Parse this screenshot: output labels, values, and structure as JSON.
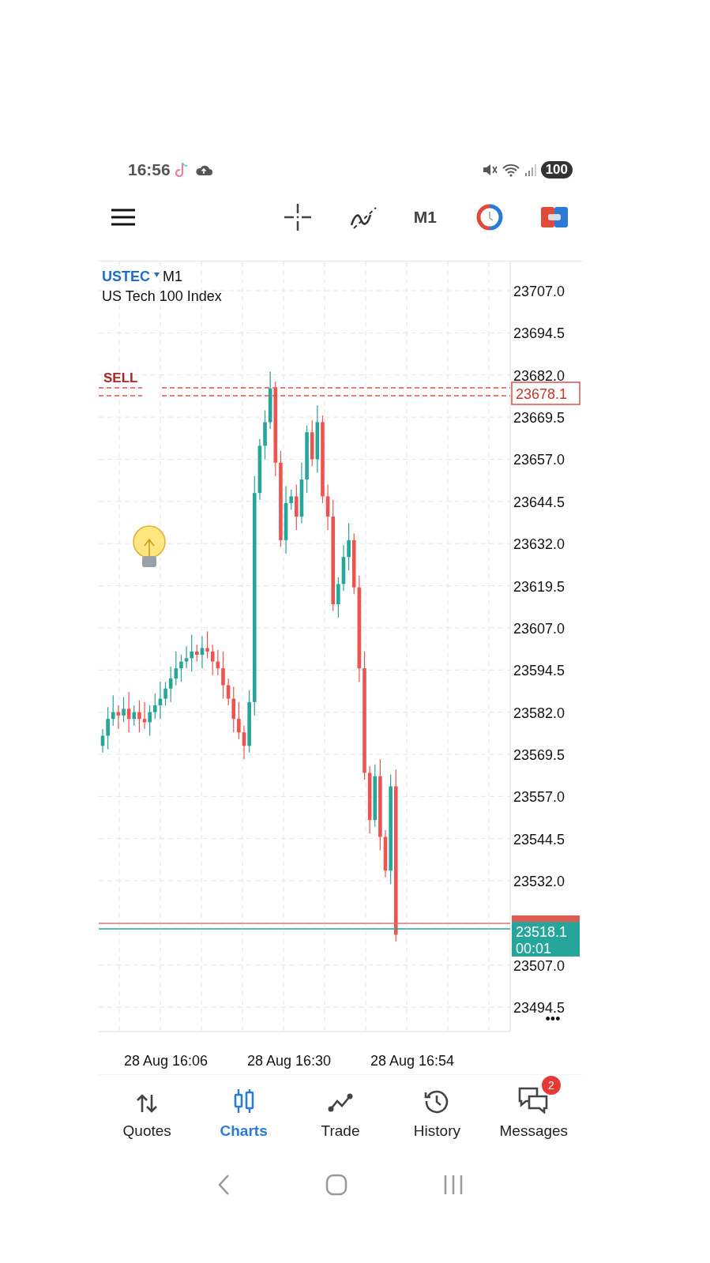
{
  "status_bar": {
    "time": "16:56",
    "battery": "100"
  },
  "toolbar": {
    "timeframe": "M1"
  },
  "chart": {
    "symbol": "USTEC",
    "timeframe": "M1",
    "description": "US Tech 100 Index",
    "order_label": "SELL",
    "price_ticks": [
      "23707.0",
      "23694.5",
      "23682.0",
      "23669.5",
      "23657.0",
      "23644.5",
      "23632.0",
      "23619.5",
      "23607.0",
      "23594.5",
      "23582.0",
      "23569.5",
      "23557.0",
      "23544.5",
      "23532.0",
      "23507.0",
      "23494.5"
    ],
    "order_price": "23678.1",
    "bid_price": "23518.1",
    "countdown": "00:01",
    "time_labels": [
      "28 Aug 16:06",
      "28 Aug 16:30",
      "28 Aug 16:54"
    ],
    "more": "•••"
  },
  "tabs": [
    {
      "label": "Quotes",
      "selected": false
    },
    {
      "label": "Charts",
      "selected": true
    },
    {
      "label": "Trade",
      "selected": false
    },
    {
      "label": "History",
      "selected": false
    },
    {
      "label": "Messages",
      "selected": false,
      "badge": "2"
    }
  ]
}
